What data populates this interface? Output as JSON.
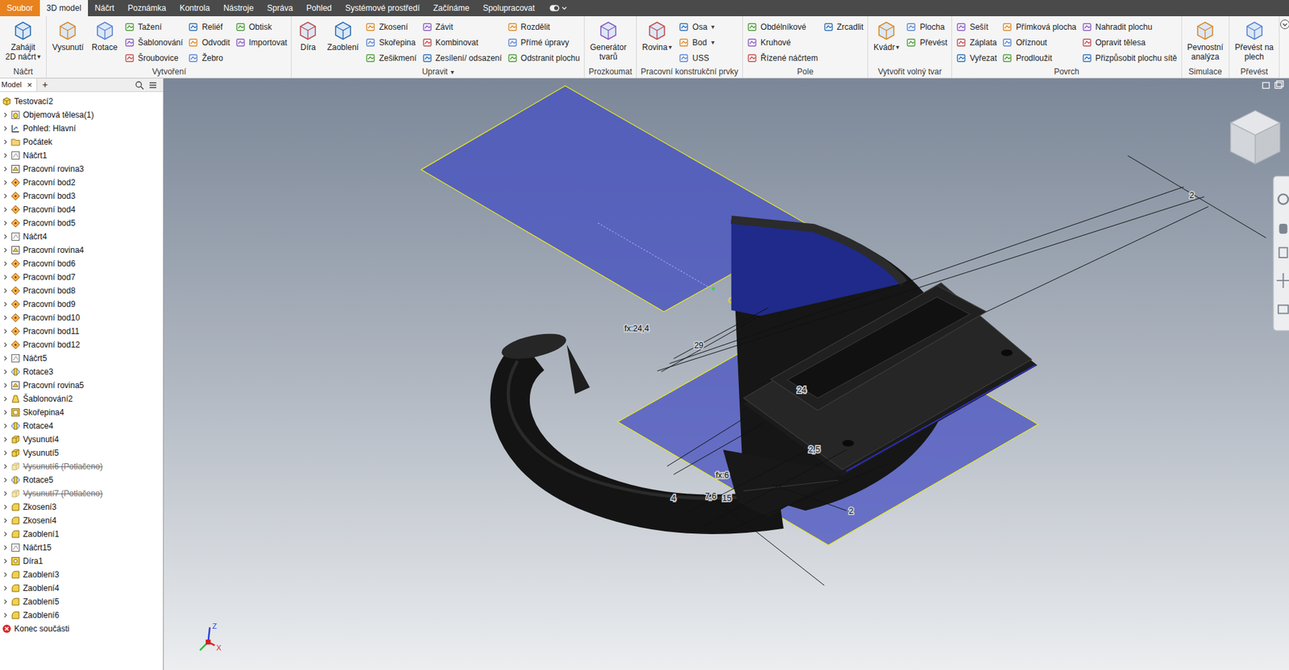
{
  "menu_tabs": [
    {
      "label": "Soubor",
      "kind": "file",
      "selected": false
    },
    {
      "label": "3D model",
      "kind": "tab",
      "selected": true
    },
    {
      "label": "Náčrt",
      "kind": "tab",
      "selected": false
    },
    {
      "label": "Poznámka",
      "kind": "tab",
      "selected": false
    },
    {
      "label": "Kontrola",
      "kind": "tab",
      "selected": false
    },
    {
      "label": "Nástroje",
      "kind": "tab",
      "selected": false
    },
    {
      "label": "Správa",
      "kind": "tab",
      "selected": false
    },
    {
      "label": "Pohled",
      "kind": "tab",
      "selected": false
    },
    {
      "label": "Systémové prostředí",
      "kind": "tab",
      "selected": false
    },
    {
      "label": "Začínáme",
      "kind": "tab",
      "selected": false
    },
    {
      "label": "Spolupracovat",
      "kind": "tab",
      "selected": false
    }
  ],
  "ribbon": {
    "panels": [
      {
        "title": "Náčrt",
        "groups": [
          {
            "kind": "big",
            "lines": [
              "Zahájit",
              "2D náčrt"
            ],
            "arrow": "▾"
          }
        ]
      },
      {
        "title": "Vytvoření",
        "groups": [
          {
            "kind": "big",
            "lines": [
              "Vysunutí"
            ]
          },
          {
            "kind": "big",
            "lines": [
              "Rotace"
            ]
          },
          {
            "kind": "column",
            "items": [
              {
                "label": "Tažení"
              },
              {
                "label": "Šablonování"
              },
              {
                "label": "Šroubovice"
              }
            ]
          },
          {
            "kind": "column",
            "items": [
              {
                "label": "Reliéf"
              },
              {
                "label": "Odvodit"
              },
              {
                "label": "Žebro"
              }
            ]
          },
          {
            "kind": "column",
            "items": [
              {
                "label": "Obtisk"
              },
              {
                "label": "Importovat"
              }
            ]
          }
        ]
      },
      {
        "title": "Upravit",
        "title_arrow": "▾",
        "groups": [
          {
            "kind": "big",
            "lines": [
              "Díra"
            ]
          },
          {
            "kind": "big",
            "lines": [
              "Zaoblení"
            ]
          },
          {
            "kind": "column",
            "items": [
              {
                "label": "Zkosení"
              },
              {
                "label": "Skořepina"
              },
              {
                "label": "Zešikmení"
              }
            ]
          },
          {
            "kind": "column",
            "items": [
              {
                "label": "Závit"
              },
              {
                "label": "Kombinovat"
              },
              {
                "label": "Zesílení/ odsazení"
              }
            ]
          },
          {
            "kind": "column",
            "items": [
              {
                "label": "Rozdělit"
              },
              {
                "label": "Přímé úpravy"
              },
              {
                "label": "Odstranit plochu"
              }
            ]
          }
        ]
      },
      {
        "title": "Prozkoumat",
        "groups": [
          {
            "kind": "big",
            "lines": [
              "Generátor",
              "tvarů"
            ]
          }
        ]
      },
      {
        "title": "Pracovní konstrukční prvky",
        "groups": [
          {
            "kind": "big",
            "lines": [
              "Rovina"
            ],
            "arrow": "▾"
          },
          {
            "kind": "column",
            "items": [
              {
                "label": "Osa",
                "arrow": "▾"
              },
              {
                "label": "Bod",
                "arrow": "▾"
              },
              {
                "label": "USS"
              }
            ]
          }
        ]
      },
      {
        "title": "Pole",
        "groups": [
          {
            "kind": "column",
            "items": [
              {
                "label": "Obdélníkové"
              },
              {
                "label": "Kruhové"
              },
              {
                "label": "Řízené náčrtem"
              }
            ]
          },
          {
            "kind": "column",
            "items": [
              {
                "label": "Zrcadlit"
              }
            ]
          }
        ]
      },
      {
        "title": "Vytvořit volný tvar",
        "groups": [
          {
            "kind": "big",
            "lines": [
              "Kvádr"
            ],
            "arrow": "▾"
          },
          {
            "kind": "column",
            "items": [
              {
                "label": "Plocha"
              },
              {
                "label": "Převést"
              }
            ]
          }
        ]
      },
      {
        "title": "Povrch",
        "groups": [
          {
            "kind": "column",
            "items": [
              {
                "label": "Sešít"
              },
              {
                "label": "Záplata"
              },
              {
                "label": "Vyřezat"
              }
            ]
          },
          {
            "kind": "column",
            "items": [
              {
                "label": "Přímková plocha"
              },
              {
                "label": "Oříznout"
              },
              {
                "label": "Prodloužit"
              }
            ]
          },
          {
            "kind": "column",
            "items": [
              {
                "label": "Nahradit plochu"
              },
              {
                "label": "Opravit tělesa"
              },
              {
                "label": "Přizpůsobit plochu sítě"
              }
            ]
          }
        ]
      },
      {
        "title": "Simulace",
        "groups": [
          {
            "kind": "big",
            "lines": [
              "Pevnostní",
              "analýza"
            ]
          }
        ]
      },
      {
        "title": "Převést",
        "groups": [
          {
            "kind": "big",
            "lines": [
              "Převést na",
              "plech"
            ]
          }
        ]
      }
    ]
  },
  "browser": {
    "tab": "Model",
    "close": "×",
    "add": "+",
    "items": [
      {
        "label": "Testovací2",
        "kind": "part",
        "collapsible": false,
        "expanded": true,
        "suppressed": false
      },
      {
        "label": "Objemová tělesa(1)",
        "kind": "bodies",
        "collapsible": true,
        "expanded": false,
        "suppressed": false
      },
      {
        "label": "Pohled: Hlavní",
        "kind": "view",
        "collapsible": true,
        "expanded": false,
        "suppressed": false
      },
      {
        "label": "Počátek",
        "kind": "folder",
        "collapsible": true,
        "expanded": false,
        "suppressed": false
      },
      {
        "label": "Náčrt1",
        "kind": "sketch",
        "collapsible": true,
        "expanded": false,
        "suppressed": false
      },
      {
        "label": "Pracovní rovina3",
        "kind": "workplane",
        "collapsible": true,
        "expanded": false,
        "suppressed": false
      },
      {
        "label": "Pracovní bod2",
        "kind": "workpoint",
        "collapsible": true,
        "expanded": false,
        "suppressed": false
      },
      {
        "label": "Pracovní bod3",
        "kind": "workpoint",
        "collapsible": true,
        "expanded": false,
        "suppressed": false
      },
      {
        "label": "Pracovní bod4",
        "kind": "workpoint",
        "collapsible": true,
        "expanded": false,
        "suppressed": false
      },
      {
        "label": "Pracovní bod5",
        "kind": "workpoint",
        "collapsible": true,
        "expanded": false,
        "suppressed": false
      },
      {
        "label": "Náčrt4",
        "kind": "sketch",
        "collapsible": true,
        "expanded": false,
        "suppressed": false
      },
      {
        "label": "Pracovní rovina4",
        "kind": "workplane",
        "collapsible": true,
        "expanded": false,
        "suppressed": false
      },
      {
        "label": "Pracovní bod6",
        "kind": "workpoint",
        "collapsible": true,
        "expanded": false,
        "suppressed": false
      },
      {
        "label": "Pracovní bod7",
        "kind": "workpoint",
        "collapsible": true,
        "expanded": false,
        "suppressed": false
      },
      {
        "label": "Pracovní bod8",
        "kind": "workpoint",
        "collapsible": true,
        "expanded": false,
        "suppressed": false
      },
      {
        "label": "Pracovní bod9",
        "kind": "workpoint",
        "collapsible": true,
        "expanded": false,
        "suppressed": false
      },
      {
        "label": "Pracovní bod10",
        "kind": "workpoint",
        "collapsible": true,
        "expanded": false,
        "suppressed": false
      },
      {
        "label": "Pracovní bod11",
        "kind": "workpoint",
        "collapsible": true,
        "expanded": false,
        "suppressed": false
      },
      {
        "label": "Pracovní bod12",
        "kind": "workpoint",
        "collapsible": true,
        "expanded": false,
        "suppressed": false
      },
      {
        "label": "Náčrt5",
        "kind": "sketch",
        "collapsible": true,
        "expanded": false,
        "suppressed": false
      },
      {
        "label": "Rotace3",
        "kind": "revolve",
        "collapsible": true,
        "expanded": false,
        "suppressed": false
      },
      {
        "label": "Pracovní rovina5",
        "kind": "workplane",
        "collapsible": true,
        "expanded": false,
        "suppressed": false
      },
      {
        "label": "Šablonování2",
        "kind": "loft",
        "collapsible": true,
        "expanded": false,
        "suppressed": false
      },
      {
        "label": "Skořepina4",
        "kind": "shell",
        "collapsible": true,
        "expanded": false,
        "suppressed": false
      },
      {
        "label": "Rotace4",
        "kind": "revolve",
        "collapsible": true,
        "expanded": false,
        "suppressed": false
      },
      {
        "label": "Vysunutí4",
        "kind": "extrude",
        "collapsible": true,
        "expanded": false,
        "suppressed": false
      },
      {
        "label": "Vysunutí5",
        "kind": "extrude",
        "collapsible": true,
        "expanded": false,
        "suppressed": false
      },
      {
        "label": "Vysunutí6 (Potlačeno)",
        "kind": "extrude",
        "collapsible": true,
        "expanded": false,
        "suppressed": true
      },
      {
        "label": "Rotace5",
        "kind": "revolve",
        "collapsible": true,
        "expanded": false,
        "suppressed": false
      },
      {
        "label": "Vysunutí7 (Potlačeno)",
        "kind": "extrude",
        "collapsible": true,
        "expanded": false,
        "suppressed": true
      },
      {
        "label": "Zkosení3",
        "kind": "chamfer",
        "collapsible": true,
        "expanded": false,
        "suppressed": false
      },
      {
        "label": "Zkosení4",
        "kind": "chamfer",
        "collapsible": true,
        "expanded": false,
        "suppressed": false
      },
      {
        "label": "Zaoblení1",
        "kind": "fillet",
        "collapsible": true,
        "expanded": false,
        "suppressed": false
      },
      {
        "label": "Náčrt15",
        "kind": "sketch",
        "collapsible": true,
        "expanded": false,
        "suppressed": false
      },
      {
        "label": "Díra1",
        "kind": "hole",
        "collapsible": true,
        "expanded": false,
        "suppressed": false
      },
      {
        "label": "Zaoblení3",
        "kind": "fillet",
        "collapsible": true,
        "expanded": false,
        "suppressed": false
      },
      {
        "label": "Zaoblení4",
        "kind": "fillet",
        "collapsible": true,
        "expanded": false,
        "suppressed": false
      },
      {
        "label": "Zaoblení5",
        "kind": "fillet",
        "collapsible": true,
        "expanded": false,
        "suppressed": false
      },
      {
        "label": "Zaoblení6",
        "kind": "fillet",
        "collapsible": true,
        "expanded": false,
        "suppressed": false
      },
      {
        "label": "Konec součásti",
        "kind": "end",
        "collapsible": false,
        "expanded": false,
        "suppressed": false
      }
    ]
  },
  "viewport": {
    "dimension_labels": [
      "fx:24,4",
      "29",
      "24",
      "2,5",
      "fx:6",
      "4",
      "7,6",
      "15",
      "2",
      "2"
    ],
    "axis_labels": [
      "Z",
      "X"
    ]
  }
}
